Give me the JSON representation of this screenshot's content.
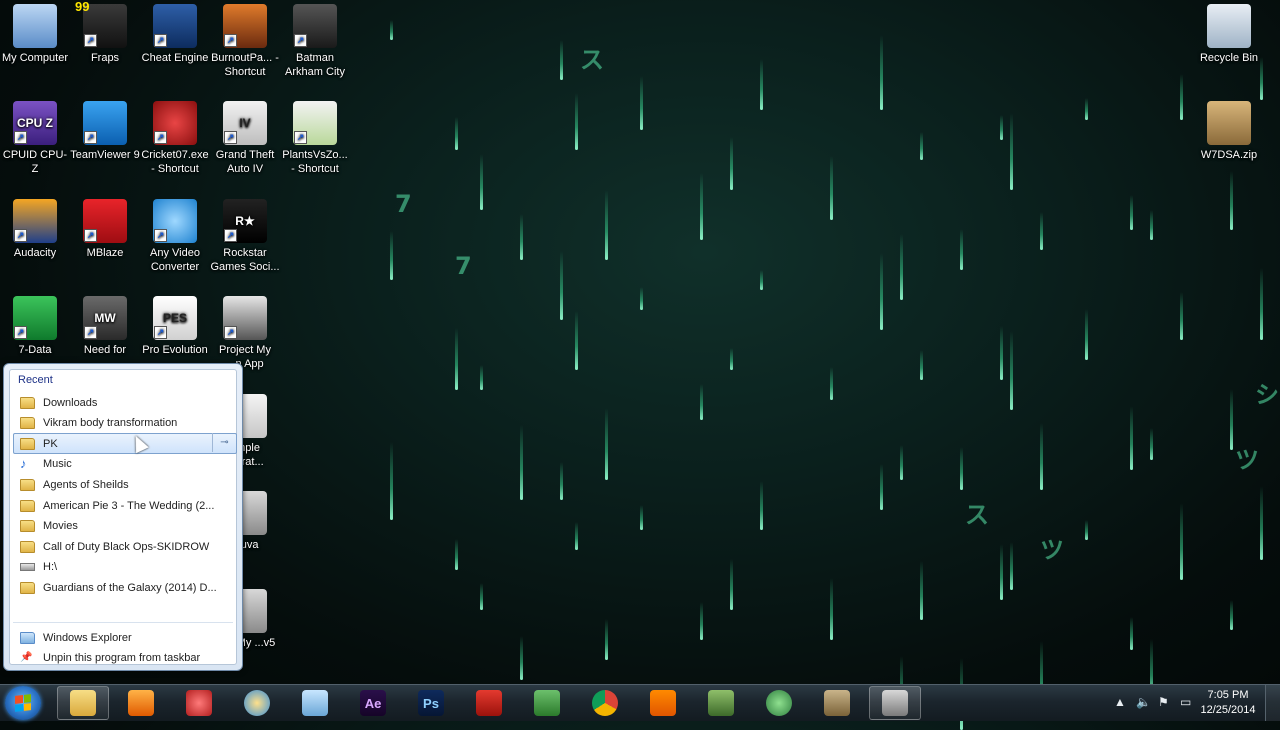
{
  "desktop": {
    "icons": [
      {
        "label": "My Computer",
        "icon": "computer-icon"
      },
      {
        "label": "Fraps",
        "icon": "fraps-icon",
        "badge": "99"
      },
      {
        "label": "Cheat Engine",
        "icon": "cheat-engine-icon"
      },
      {
        "label": "BurnoutPa... - Shortcut",
        "icon": "burnout-icon"
      },
      {
        "label": "Batman Arkham City",
        "icon": "batman-icon"
      },
      {
        "label": "CPUID CPU-Z",
        "icon": "cpuz-icon",
        "glyph": "CPU Z"
      },
      {
        "label": "TeamViewer 9",
        "icon": "teamviewer-icon"
      },
      {
        "label": "Cricket07.exe - Shortcut",
        "icon": "cricket-icon"
      },
      {
        "label": "Grand Theft Auto IV",
        "icon": "gta-icon",
        "glyph": "IV"
      },
      {
        "label": "PlantsVsZo... - Shortcut",
        "icon": "plants-icon"
      },
      {
        "label": "Audacity",
        "icon": "audacity-icon"
      },
      {
        "label": "MBlaze",
        "icon": "mblaze-icon"
      },
      {
        "label": "Any Video Converter",
        "icon": "video-converter-icon"
      },
      {
        "label": "Rockstar Games Soci...",
        "icon": "rockstar-icon",
        "glyph": "R★"
      },
      {
        "label": "7-Data",
        "icon": "data-recovery-icon"
      },
      {
        "label": "Need for",
        "icon": "nfs-icon",
        "glyph": "MW"
      },
      {
        "label": "Pro Evolution",
        "icon": "pes-icon",
        "glyph": "PES"
      },
      {
        "label": "Project My ...n App",
        "icon": "project-app-icon"
      },
      {
        "label": "...nple ...urat...",
        "icon": "file-icon"
      },
      {
        "label": "...uva",
        "icon": "app-icon"
      },
      {
        "label": "...er My ...v5",
        "icon": "app-icon"
      },
      {
        "label": "Recycle Bin",
        "icon": "recycle-bin-icon"
      },
      {
        "label": "W7DSA.zip",
        "icon": "zip-archive-icon"
      }
    ]
  },
  "jumplist": {
    "heading": "Recent",
    "recent": [
      {
        "label": "Downloads",
        "icon": "folder-icon"
      },
      {
        "label": "Vikram body transformation",
        "icon": "folder-icon"
      },
      {
        "label": "PK",
        "icon": "folder-icon",
        "highlighted": true
      },
      {
        "label": "Music",
        "icon": "music-icon"
      },
      {
        "label": "Agents of Sheilds",
        "icon": "folder-icon"
      },
      {
        "label": "American Pie 3 - The Wedding (2...",
        "icon": "folder-icon"
      },
      {
        "label": "Movies",
        "icon": "folder-icon"
      },
      {
        "label": "Call of Duty Black Ops-SKIDROW",
        "icon": "folder-icon"
      },
      {
        "label": "H:\\",
        "icon": "drive-icon"
      },
      {
        "label": "Guardians of the Galaxy (2014) D...",
        "icon": "folder-icon"
      }
    ],
    "tasks": [
      {
        "label": "Windows Explorer",
        "icon": "explorer-icon"
      },
      {
        "label": "Unpin this program from taskbar",
        "icon": "unpin-icon"
      }
    ]
  },
  "taskbar": {
    "apps": [
      {
        "name": "Windows Explorer",
        "icon": "explorer-icon",
        "active": true
      },
      {
        "name": "Media Player",
        "icon": "media-player-icon"
      },
      {
        "name": "Snipping Tool",
        "icon": "snipping-icon"
      },
      {
        "name": "Paint",
        "icon": "paint-icon"
      },
      {
        "name": "Notepad",
        "icon": "notepad-icon"
      },
      {
        "name": "After Effects",
        "icon": "after-effects-icon",
        "glyph": "Ae"
      },
      {
        "name": "Photoshop",
        "icon": "photoshop-icon",
        "glyph": "Ps"
      },
      {
        "name": "Adobe Reader",
        "icon": "adobe-reader-icon"
      },
      {
        "name": "Camtasia",
        "icon": "camtasia-icon"
      },
      {
        "name": "Google Chrome",
        "icon": "chrome-icon"
      },
      {
        "name": "VLC",
        "icon": "vlc-icon"
      },
      {
        "name": "App",
        "icon": "app-icon"
      },
      {
        "name": "Globe",
        "icon": "globe-icon"
      },
      {
        "name": "Archive",
        "icon": "archive-icon"
      },
      {
        "name": "Recorder",
        "icon": "recorder-icon",
        "active": true
      }
    ],
    "clock": {
      "time": "7:05 PM",
      "date": "12/25/2014"
    }
  }
}
